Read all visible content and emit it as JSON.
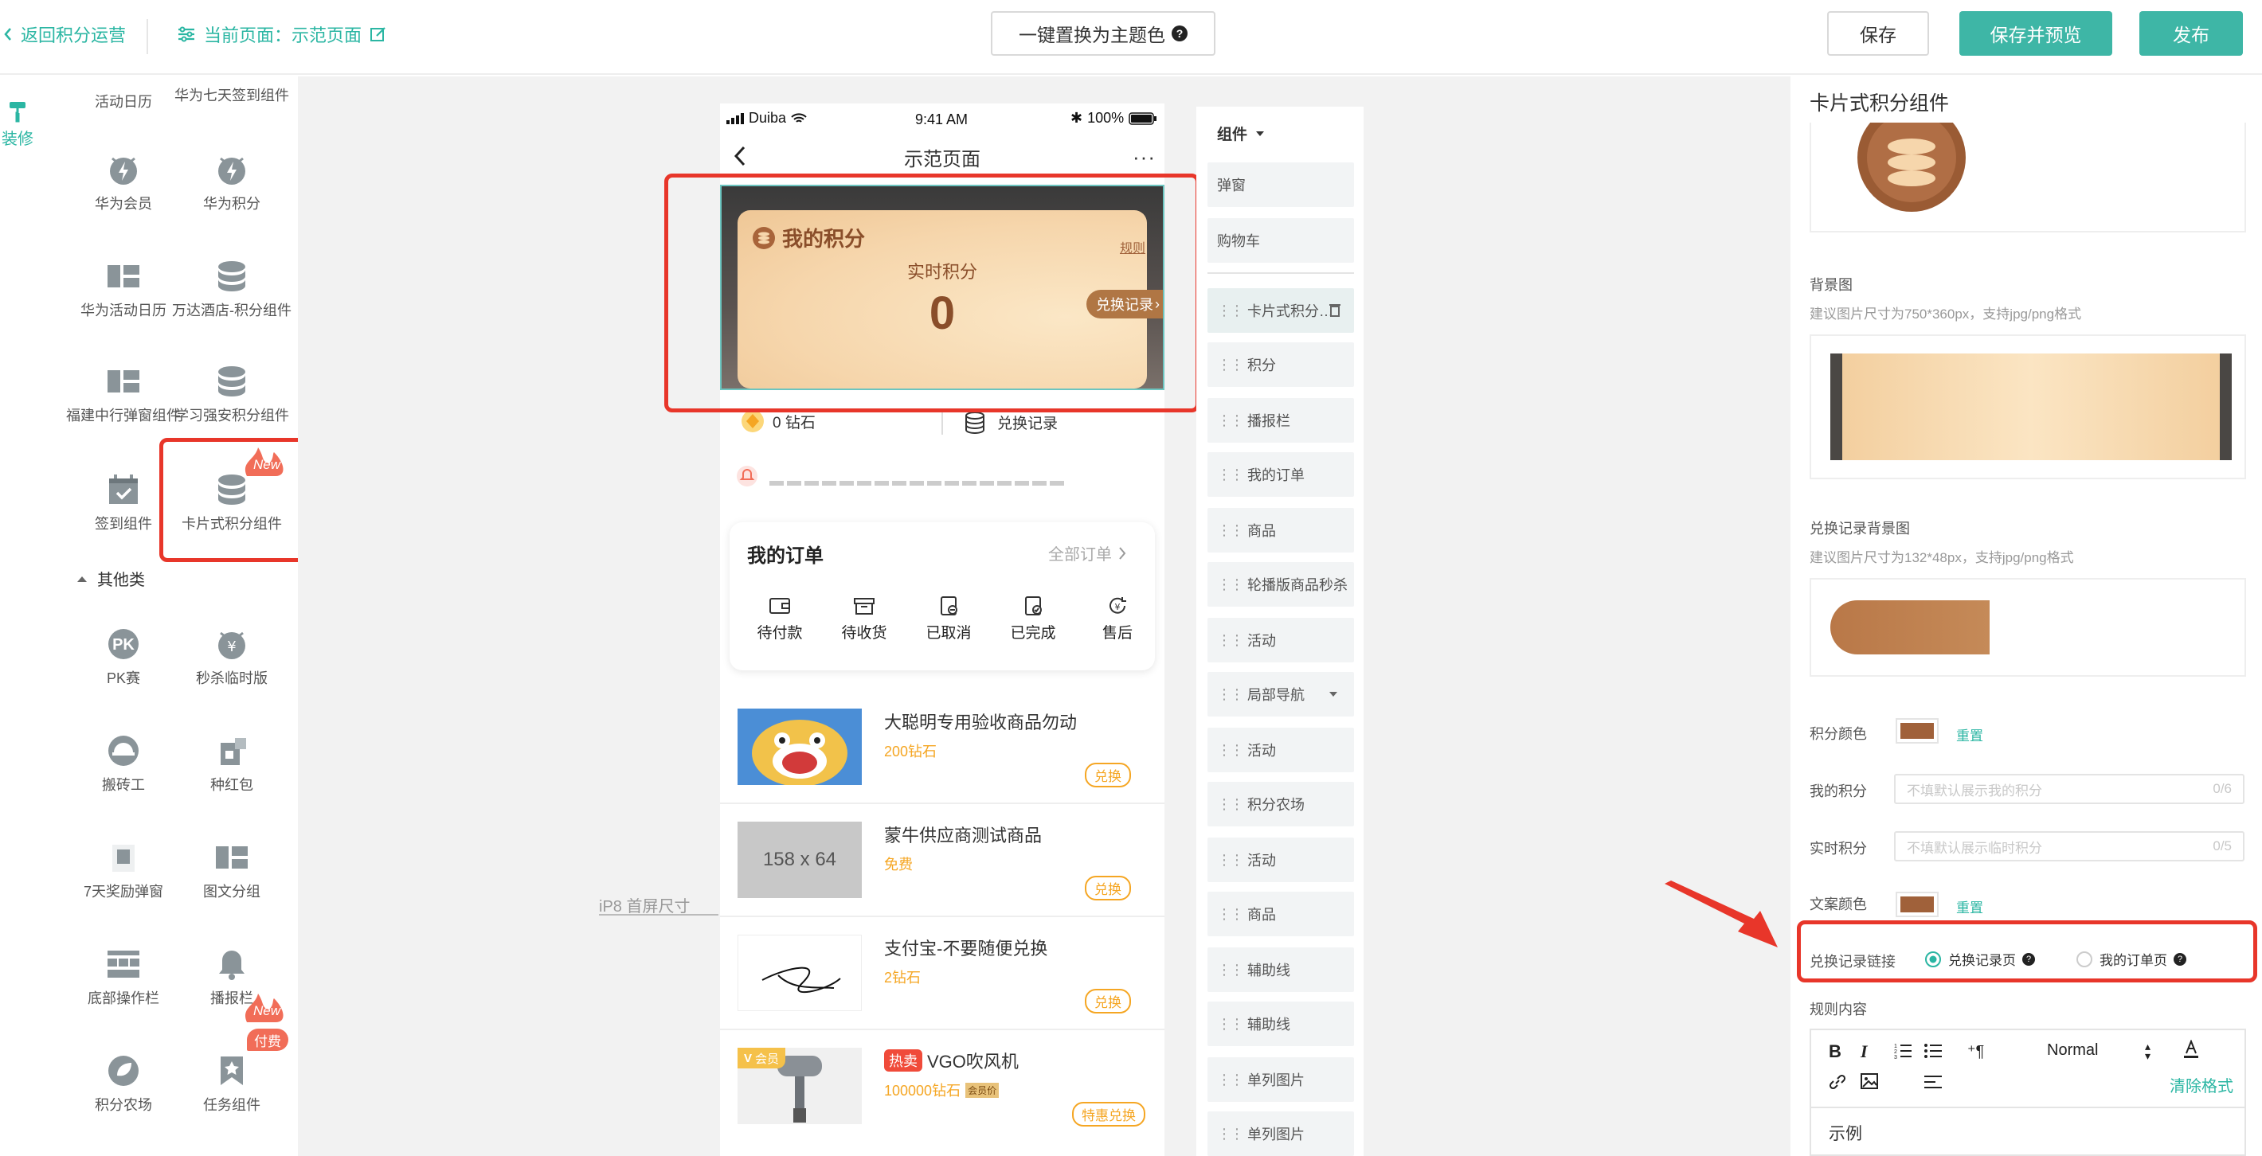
{
  "header": {
    "back_label": "返回积分运营",
    "current_page_label": "当前页面：示范页面",
    "theme_button": "一键置换为主题色",
    "save": "保存",
    "save_preview": "保存并预览",
    "publish": "发布"
  },
  "tab": {
    "label": "装修"
  },
  "left_components": [
    {
      "label": "活动日历",
      "icon": "calendar-icon"
    },
    {
      "label": "华为七天签到组件",
      "icon": "calendar-check-icon"
    },
    {
      "label": "华为会员",
      "icon": "lightning-icon"
    },
    {
      "label": "华为积分",
      "icon": "alarm-icon"
    },
    {
      "label": "华为活动日历",
      "icon": "grid-icon"
    },
    {
      "label": "万达酒店-积分组件",
      "icon": "database-icon"
    },
    {
      "label": "福建中行弹窗组件",
      "icon": "grid-icon"
    },
    {
      "label": "学习强安积分组件",
      "icon": "database-icon"
    },
    {
      "label": "签到组件",
      "icon": "calendar-check-icon"
    },
    {
      "label": "卡片式积分组件",
      "icon": "database-icon",
      "badge": "New"
    }
  ],
  "other_category": {
    "title": "其他类",
    "items": [
      {
        "label": "PK赛",
        "icon": "pk-icon"
      },
      {
        "label": "秒杀临时版",
        "icon": "alarm-yen-icon"
      },
      {
        "label": "搬砖工",
        "icon": "helmet-icon"
      },
      {
        "label": "种红包",
        "icon": "redpacket-icon"
      },
      {
        "label": "7天奖励弹窗",
        "icon": "popup-icon"
      },
      {
        "label": "图文分组",
        "icon": "grid-icon"
      },
      {
        "label": "底部操作栏",
        "icon": "bottombar-icon"
      },
      {
        "label": "播报栏",
        "icon": "bell-icon",
        "badge": "New"
      },
      {
        "label": "积分农场",
        "icon": "leaf-icon"
      },
      {
        "label": "任务组件",
        "icon": "bookmark-icon",
        "badge": "付费"
      }
    ]
  },
  "canvas": {
    "ip8_label": "iP8 首屏尺寸"
  },
  "phone": {
    "carrier": "Duiba",
    "time": "9:41 AM",
    "battery": "100%",
    "page_title": "示范页面",
    "points_card": {
      "title": "我的积分",
      "rule": "规则",
      "realtime_label": "实时积分",
      "value": "0",
      "exchange_button": "兑换记录"
    },
    "diamond_text": "0 钻石",
    "exchange_record_text": "兑换记录",
    "orders": {
      "title": "我的订单",
      "all_orders": "全部订单",
      "items": [
        "待付款",
        "待收货",
        "已取消",
        "已完成",
        "售后"
      ]
    },
    "products": [
      {
        "title": "大聪明专用验收商品勿动",
        "price": "200钻石",
        "button": "兑换"
      },
      {
        "title": "蒙牛供应商测试商品",
        "price": "免费",
        "button": "兑换",
        "placeholder": "158 x 64"
      },
      {
        "title": "支付宝-不要随便兑换",
        "price": "2钻石",
        "button": "兑换"
      },
      {
        "title": "VGO吹风机",
        "tag": "热卖",
        "price": "100000钻石",
        "member_tag": "会员价",
        "button": "特惠兑换",
        "vip_tag": "会员"
      }
    ]
  },
  "component_list": {
    "header": "组件",
    "items": [
      "弹窗",
      "购物车",
      "卡片式积分…",
      "积分",
      "播报栏",
      "我的订单",
      "商品",
      "轮播版商品秒杀",
      "活动",
      "局部导航",
      "活动",
      "积分农场",
      "活动",
      "商品",
      "辅助线",
      "辅助线",
      "单列图片",
      "单列图片"
    ]
  },
  "right_panel": {
    "title": "卡片式积分组件",
    "bg_label": "背景图",
    "bg_hint": "建议图片尺寸为750*360px，支持jpg/png格式",
    "exchange_bg_label": "兑换记录背景图",
    "exchange_bg_hint": "建议图片尺寸为132*48px，支持jpg/png格式",
    "points_color_label": "积分颜色",
    "reset": "重置",
    "my_points_label": "我的积分",
    "my_points_placeholder": "不填默认展示我的积分",
    "my_points_count": "0/6",
    "realtime_label": "实时积分",
    "realtime_placeholder": "不填默认展示临时积分",
    "realtime_count": "0/5",
    "text_color_label": "文案颜色",
    "link_label": "兑换记录链接",
    "link_options": [
      "兑换记录页",
      "我的订单页"
    ],
    "rules_label": "规则内容",
    "editor_format": "Normal",
    "clear_format": "清除格式",
    "editor_content": "示例",
    "points_color": "#a0613a"
  }
}
